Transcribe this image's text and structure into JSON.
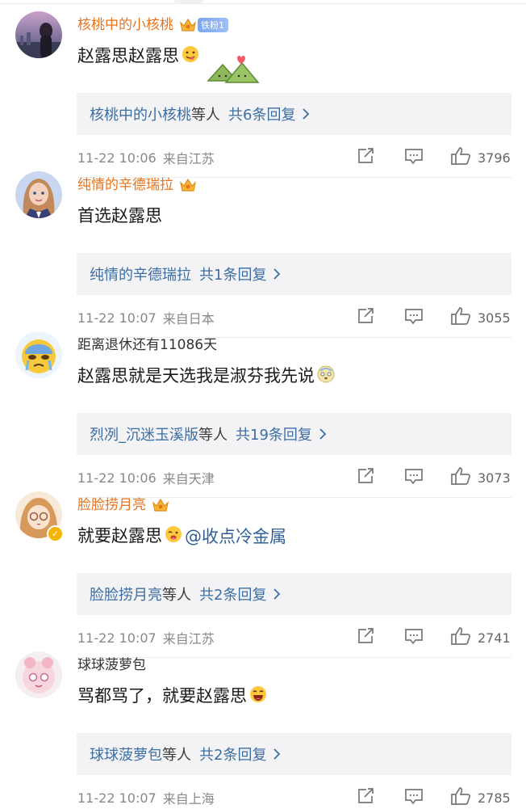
{
  "comments": [
    {
      "username": "核桃中的小核桃",
      "fan_badge": "铁粉1",
      "text": "赵露思赵露思",
      "mention": "",
      "reply_names": "核桃中的小核桃",
      "reply_suffix": "等人",
      "reply_count": "共6条回复",
      "timestamp": "11-22 10:06",
      "location": "来自江苏",
      "likes": "3796"
    },
    {
      "username": "纯情的辛德瑞拉",
      "text": "首选赵露思",
      "mention": "",
      "reply_names": "纯情的辛德瑞拉",
      "reply_suffix": "",
      "reply_count": "共1条回复",
      "timestamp": "11-22 10:07",
      "location": "来自日本",
      "likes": "3055"
    },
    {
      "username": "距离退休还有11086天",
      "text": "赵露思就是天选我是淑芬我先说",
      "mention": "",
      "reply_names": "烈冽_沉迷玉溪版",
      "reply_suffix": "等人",
      "reply_count": "共19条回复",
      "timestamp": "11-22 10:06",
      "location": "来自天津",
      "likes": "3073"
    },
    {
      "username": "脸脸捞月亮",
      "text": "就要赵露思",
      "mention": "@收点冷金属",
      "reply_names": "脸脸捞月亮",
      "reply_suffix": "等人",
      "reply_count": "共2条回复",
      "timestamp": "11-22 10:07",
      "location": "来自江苏",
      "likes": "2741"
    },
    {
      "username": "球球菠萝包",
      "text": "骂都骂了，就要赵露思",
      "mention": "",
      "reply_names": "球球菠萝包",
      "reply_suffix": "等人",
      "reply_count": "共2条回复",
      "timestamp": "11-22 10:07",
      "location": "来自上海",
      "likes": "2785"
    }
  ],
  "icons": {
    "share": "share-icon",
    "comment": "comment-icon",
    "like": "like-icon",
    "crown": "crown-badge-icon",
    "chevron": "chevron-right-icon"
  },
  "colors": {
    "vip_name": "#e8731c",
    "link_blue": "#3d6ea3",
    "reply_bg": "#f3f3f5",
    "meta_gray": "#888888"
  }
}
